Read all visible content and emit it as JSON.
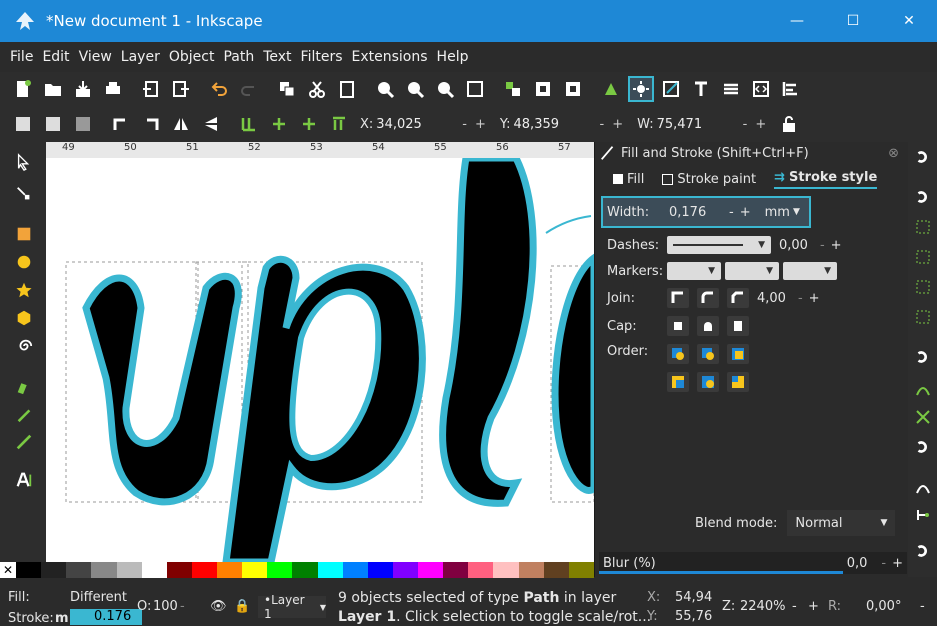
{
  "window": {
    "title": "*New document 1 - Inkscape",
    "minimize": "—",
    "maximize": "☐",
    "close": "✕"
  },
  "menu": [
    "File",
    "Edit",
    "View",
    "Layer",
    "Object",
    "Path",
    "Text",
    "Filters",
    "Extensions",
    "Help"
  ],
  "coords": {
    "x_label": "X:",
    "x_value": "34,025",
    "y_label": "Y:",
    "y_value": "48,359",
    "w_label": "W:",
    "w_value": "75,471",
    "minus": "-",
    "plus": "+"
  },
  "ruler": [
    "49",
    "50",
    "51",
    "52",
    "53",
    "54",
    "55",
    "56",
    "57"
  ],
  "dialog": {
    "title": "Fill and Stroke (Shift+Ctrl+F)",
    "tabs": [
      "Fill",
      "Stroke paint",
      "Stroke style"
    ],
    "width_label": "Width:",
    "width_value": "0,176",
    "width_unit": "mm",
    "dashes_label": "Dashes:",
    "dashes_value": "0,00",
    "markers_label": "Markers:",
    "join_label": "Join:",
    "join_value": "4,00",
    "cap_label": "Cap:",
    "order_label": "Order:",
    "blend_label": "Blend mode:",
    "blend_value": "Normal",
    "blur_label": "Blur (%)",
    "blur_value": "0,0"
  },
  "status": {
    "fill_label": "Fill:",
    "fill_value": "Different",
    "stroke_label": "Stroke:",
    "stroke_value": "0.176",
    "stroke_prefix": "m",
    "opacity_label": "O:",
    "opacity_value": "100",
    "layer": "•Layer 1",
    "message_line1_pre": "9 objects selected of type ",
    "message_line1_bold": "Path",
    "message_line1_post": " in layer",
    "message_line2_bold": "Layer 1",
    "message_line2_post": ". Click selection to toggle scale/rot...",
    "x_label": "X:",
    "x_value": "54,94",
    "y_label": "Y:",
    "y_value": "55,76",
    "z_label": "Z:",
    "zoom": "2240%",
    "r_label": "R:",
    "rotation": "0,00°"
  },
  "colors": {
    "accent": "#3ab7d1",
    "titlebar": "#1e88d6",
    "bg": "#2b2b2b"
  },
  "palette": [
    "#000000",
    "#222222",
    "#444444",
    "#888888",
    "#bbbbbb",
    "#ffffff",
    "#800000",
    "#ff0000",
    "#ff8000",
    "#ffff00",
    "#00ff00",
    "#008000",
    "#00ffff",
    "#0080ff",
    "#0000ff",
    "#8000ff",
    "#ff00ff",
    "#800040",
    "#ff6080",
    "#ffc0c0",
    "#c08060",
    "#604020",
    "#808000"
  ]
}
